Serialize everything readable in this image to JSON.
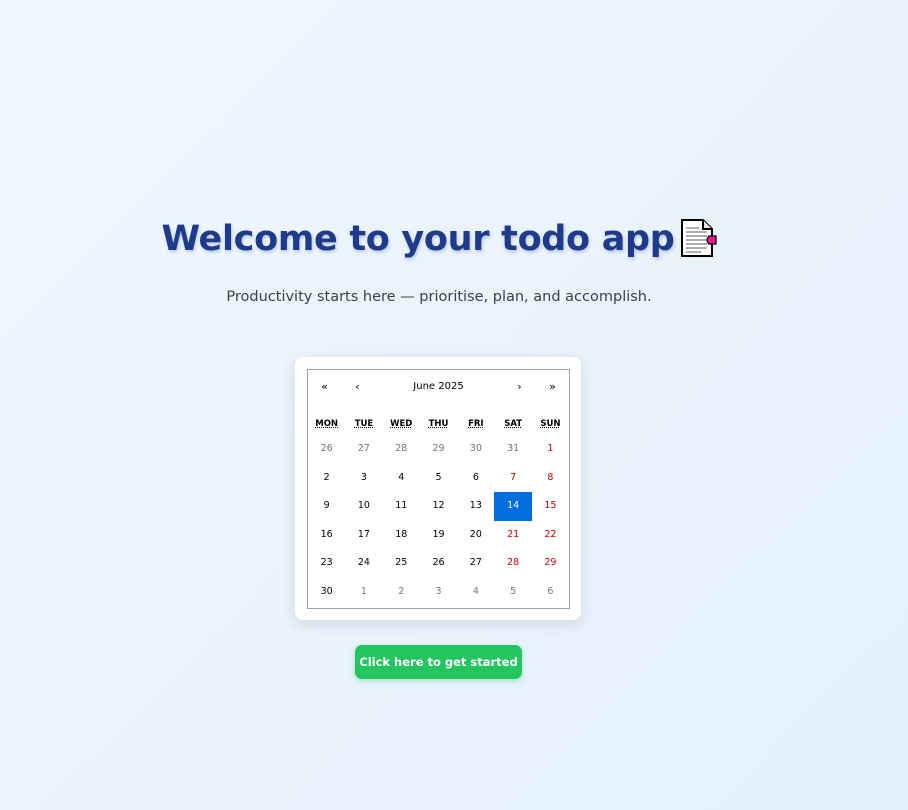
{
  "header": {
    "title": "Welcome to your todo app",
    "title_icon": "page-document-icon",
    "subtitle": "Productivity starts here — prioritise, plan, and accomplish."
  },
  "calendar": {
    "nav": {
      "prev_year": "«",
      "prev_month": "‹",
      "label": "June 2025",
      "next_month": "›",
      "next_year": "»"
    },
    "weekdays": [
      "MON",
      "TUE",
      "WED",
      "THU",
      "FRI",
      "SAT",
      "SUN"
    ],
    "days": [
      {
        "label": "26",
        "other": true,
        "weekend": false
      },
      {
        "label": "27",
        "other": true,
        "weekend": false
      },
      {
        "label": "28",
        "other": true,
        "weekend": false
      },
      {
        "label": "29",
        "other": true,
        "weekend": false
      },
      {
        "label": "30",
        "other": true,
        "weekend": false
      },
      {
        "label": "31",
        "other": true,
        "weekend": true
      },
      {
        "label": "1",
        "other": false,
        "weekend": true
      },
      {
        "label": "2",
        "other": false,
        "weekend": false
      },
      {
        "label": "3",
        "other": false,
        "weekend": false
      },
      {
        "label": "4",
        "other": false,
        "weekend": false
      },
      {
        "label": "5",
        "other": false,
        "weekend": false
      },
      {
        "label": "6",
        "other": false,
        "weekend": false
      },
      {
        "label": "7",
        "other": false,
        "weekend": true
      },
      {
        "label": "8",
        "other": false,
        "weekend": true
      },
      {
        "label": "9",
        "other": false,
        "weekend": false
      },
      {
        "label": "10",
        "other": false,
        "weekend": false
      },
      {
        "label": "11",
        "other": false,
        "weekend": false
      },
      {
        "label": "12",
        "other": false,
        "weekend": false
      },
      {
        "label": "13",
        "other": false,
        "weekend": false
      },
      {
        "label": "14",
        "other": false,
        "weekend": true,
        "selected": true
      },
      {
        "label": "15",
        "other": false,
        "weekend": true
      },
      {
        "label": "16",
        "other": false,
        "weekend": false
      },
      {
        "label": "17",
        "other": false,
        "weekend": false
      },
      {
        "label": "18",
        "other": false,
        "weekend": false
      },
      {
        "label": "19",
        "other": false,
        "weekend": false
      },
      {
        "label": "20",
        "other": false,
        "weekend": false
      },
      {
        "label": "21",
        "other": false,
        "weekend": true
      },
      {
        "label": "22",
        "other": false,
        "weekend": true
      },
      {
        "label": "23",
        "other": false,
        "weekend": false
      },
      {
        "label": "24",
        "other": false,
        "weekend": false
      },
      {
        "label": "25",
        "other": false,
        "weekend": false
      },
      {
        "label": "26",
        "other": false,
        "weekend": false
      },
      {
        "label": "27",
        "other": false,
        "weekend": false
      },
      {
        "label": "28",
        "other": false,
        "weekend": true
      },
      {
        "label": "29",
        "other": false,
        "weekend": true
      },
      {
        "label": "30",
        "other": false,
        "weekend": false
      },
      {
        "label": "1",
        "other": true,
        "weekend": false
      },
      {
        "label": "2",
        "other": true,
        "weekend": false
      },
      {
        "label": "3",
        "other": true,
        "weekend": false
      },
      {
        "label": "4",
        "other": true,
        "weekend": false
      },
      {
        "label": "5",
        "other": true,
        "weekend": true
      },
      {
        "label": "6",
        "other": true,
        "weekend": true
      }
    ]
  },
  "cta": {
    "label": "Click here to get started"
  },
  "colors": {
    "title": "#1e3a8a",
    "selected_day": "#006edc",
    "weekend_day": "#d10000",
    "cta_background": "#22c55e"
  }
}
